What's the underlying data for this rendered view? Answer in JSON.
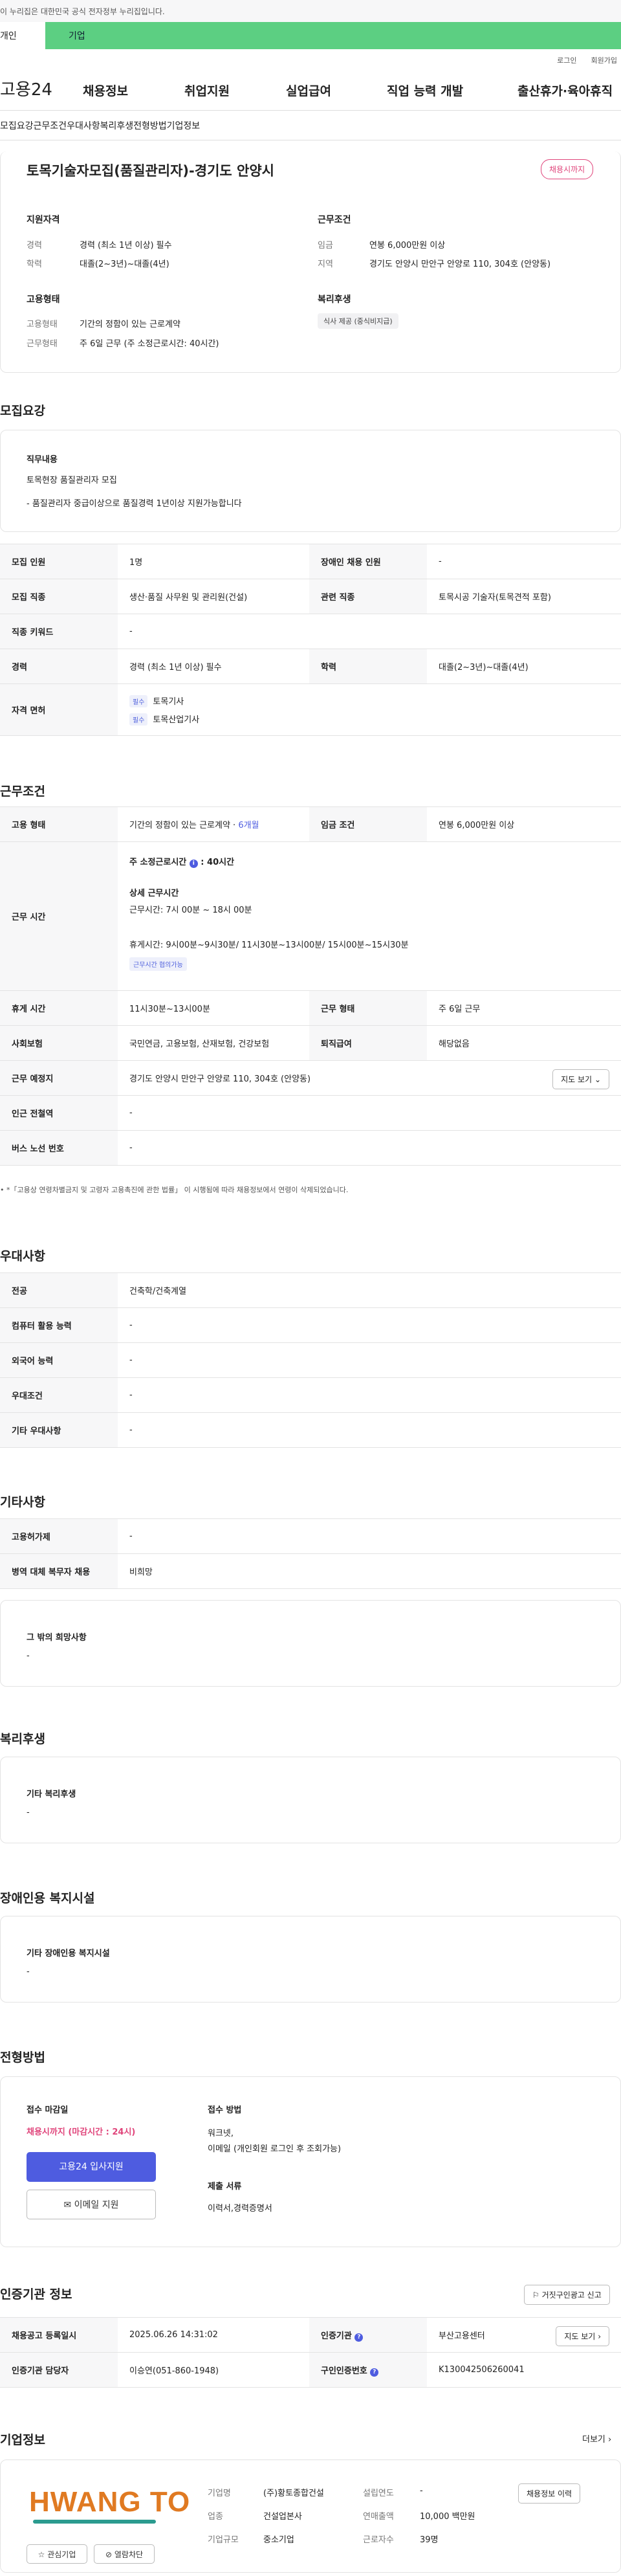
{
  "gov_notice": "이 누리집은 대한민국 공식 전자정부 누리집입니다.",
  "service_tabs": [
    "개인",
    "기업"
  ],
  "util_links": [
    "로그인",
    "회원가입"
  ],
  "logo": "고용24",
  "gnb": [
    "채용정보",
    "취업지원",
    "실업급여",
    "직업 능력 개발",
    "출산휴가·육아휴직"
  ],
  "subnav": [
    "모집요강",
    "근무조건",
    "우대사항",
    "복리후생",
    "전형방법",
    "기업정보"
  ],
  "job": {
    "title": "토목기술자모집(품질관리자)-경기도 안양시",
    "badge": "채용시까지",
    "qual_head": "지원자격",
    "career_lbl": "경력",
    "career": "경력 (최소 1년 이상) 필수",
    "edu_lbl": "학력",
    "edu": "대졸(2~3년)~대졸(4년)",
    "cond_head": "근무조건",
    "wage_lbl": "임금",
    "wage": "연봉 6,000만원 이상",
    "area_lbl": "지역",
    "area": "경기도 안양시 만안구 안양로 110, 304호 (안양동)",
    "emp_head": "고용형태",
    "emp_lbl": "고용형태",
    "emp": "기간의 정함이 있는 근로계약",
    "work_lbl": "근무형태",
    "work": "주 6일 근무 (주 소정근로시간: 40시간)",
    "welfare_head": "복리후생",
    "welfare_tag": "식사 제공 (중식비지급)"
  },
  "recruit": {
    "head": "모집요강",
    "duty_head": "직무내용",
    "duty1": "토목현장 품질관리자 모집",
    "duty2": "- 품질관리자 중급이상으로 품질경력 1년이상 지원가능합니다",
    "rows": [
      [
        "모집 인원",
        "1명",
        "장애인 채용 인원",
        "-"
      ],
      [
        "모집 직종",
        "생산·품질 사무원 및 관리원(건설)",
        "관련 직종",
        "토목시공 기술자(토목견적 포함)"
      ],
      [
        "직종 키워드",
        "-",
        "",
        ""
      ],
      [
        "경력",
        "경력 (최소 1년 이상) 필수",
        "학력",
        "대졸(2~3년)~대졸(4년)"
      ]
    ],
    "license_lbl": "자격 면허",
    "req_tag": "필수",
    "license1": "토목기사",
    "license2": "토목산업기사"
  },
  "workcond": {
    "head": "근무조건",
    "emp_lbl": "고용 형태",
    "emp": "기간의 정함이 있는 근로계약",
    "emp_period": "6개월",
    "wage_lbl": "임금 조건",
    "wage": "연봉 6,000만원 이상",
    "time_lbl": "근무 시간",
    "weekly_lbl": "주 소정근로시간",
    "weekly": "40시간",
    "detail_head": "상세 근무시간",
    "detail1": "근무시간: 7시 00분 ~ 18시 00분",
    "detail2": "휴게시간: 9시00분~9시30분/ 11시30분~13시00분/ 15시00분~15시30분",
    "flex": "근무시간 협의가능",
    "rows": [
      [
        "휴게 시간",
        "11시30분~13시00분",
        "근무 형태",
        "주 6일 근무"
      ],
      [
        "사회보험",
        "국민연금, 고용보험, 산재보험, 건강보험",
        "퇴직급여",
        "해당없음"
      ]
    ],
    "place_lbl": "근무 예정지",
    "place": "경기도 안양시 만안구 안양로 110, 304호 (안양동)",
    "map_btn": "지도 보기",
    "subway_lbl": "인근 전철역",
    "subway": "-",
    "bus_lbl": "버스 노선 번호",
    "bus": "-",
    "note": "*「고용상 연령차별금지 및 고령자 고용촉진에 관한 법률」 이 시행됨에 따라 채용정보에서 연령이 삭제되었습니다."
  },
  "pref": {
    "head": "우대사항",
    "rows": [
      [
        "전공",
        "건축학/건축계열"
      ],
      [
        "컴퓨터 활용 능력",
        "-"
      ],
      [
        "외국어 능력",
        "-"
      ],
      [
        "우대조건",
        "-"
      ],
      [
        "기타 우대사항",
        "-"
      ]
    ]
  },
  "etc": {
    "head": "기타사항",
    "rows": [
      [
        "고용허가제",
        "-"
      ],
      [
        "병역 대체 복무자 채용",
        "비희망"
      ]
    ],
    "wish_head": "그 밖의 희망사항",
    "wish": "-"
  },
  "benefits": {
    "head": "복리후생",
    "sub": "기타 복리후생",
    "val": "-"
  },
  "disabled": {
    "head": "장애인용 복지시설",
    "sub": "기타 장애인용 복지시설",
    "val": "-"
  },
  "selection": {
    "head": "전형방법",
    "deadline_lbl": "접수 마감일",
    "deadline": "채용시까지 (마감시간 : 24시)",
    "apply_btn": "고용24 입사지원",
    "email_btn": "이메일 지원",
    "method_lbl": "접수 방법",
    "method1": "워크넷,",
    "method2": "이메일 (개인회원 로그인 후 조회가능)",
    "docs_lbl": "제출 서류",
    "docs": "이력서,경력증명서"
  },
  "agency": {
    "head": "인증기관 정보",
    "report_btn": "거짓구인광고 신고",
    "reg_lbl": "채용공고 등록일시",
    "reg": "2025.06.26 14:31:02",
    "org_lbl": "인증기관",
    "org": "부산고용센터",
    "map_btn": "지도 보기",
    "staff_lbl": "인증기관 담당자",
    "staff": "이승연(051-860-1948)",
    "num_lbl": "구인인증번호",
    "num": "K130042506260041"
  },
  "company": {
    "head": "기업정보",
    "more": "더보기",
    "logo_text": "HWANG TO",
    "name_lbl": "기업명",
    "name": "(주)황토종합건설",
    "year_lbl": "설립연도",
    "year": "-",
    "ind_lbl": "업종",
    "ind": "건설업본사",
    "sales_lbl": "연매출액",
    "sales": "10,000 백만원",
    "size_lbl": "기업규모",
    "size": "중소기업",
    "emp_lbl": "근로자수",
    "emp": "39명",
    "history_btn": "채용정보 이력",
    "fav_btn": "관심기업",
    "block_btn": "열람차단"
  },
  "colors": {
    "accent": "#4e5ce0",
    "green": "#5ccf82",
    "pink": "#e0457b",
    "logo_orange": "#e07a22",
    "logo_teal": "#2b9b8f"
  }
}
